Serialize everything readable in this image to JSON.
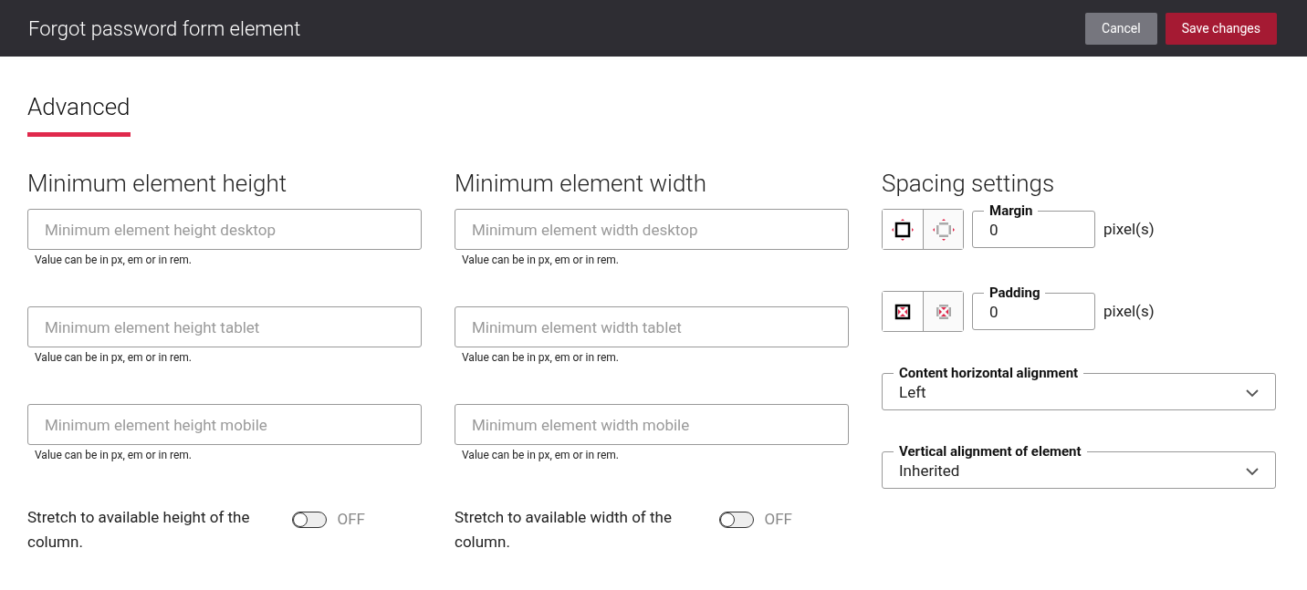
{
  "header": {
    "title": "Forgot password form element",
    "buttons": [
      {
        "label": "Cancel",
        "kind": "secondary"
      },
      {
        "label": "Save changes",
        "kind": "primary"
      }
    ]
  },
  "tabs": [
    {
      "label": "Advanced",
      "selected": true
    }
  ],
  "columns": [
    {
      "title": "Minimum element height",
      "fields": [
        {
          "placeholder": "Minimum element height desktop",
          "hint": "Value can be in px, em or in rem."
        },
        {
          "placeholder": "Minimum element height tablet",
          "hint": "Value can be in px, em or in rem."
        },
        {
          "placeholder": "Minimum element height mobile",
          "hint": "Value can be in px, em or in rem."
        }
      ],
      "toggle": {
        "label": "Stretch to available height of the column.",
        "on": false,
        "state_text": "OFF"
      }
    },
    {
      "title": "Minimum element width",
      "fields": [
        {
          "placeholder": "Minimum element width desktop",
          "hint": "Value can be in px, em or in rem."
        },
        {
          "placeholder": "Minimum element width tablet",
          "hint": "Value can be in px, em or in rem."
        },
        {
          "placeholder": "Minimum element width mobile",
          "hint": "Value can be in px, em or in rem."
        }
      ],
      "toggle": {
        "label": "Stretch to available width of the column.",
        "on": false,
        "state_text": "OFF"
      }
    }
  ],
  "spacing": {
    "title": "Spacing settings",
    "rows": [
      {
        "kind": "margin",
        "label": "Margin",
        "value": "0",
        "unit": "pixel(s)",
        "modes": [
          {
            "kind": "all",
            "selected": true
          },
          {
            "kind": "sides",
            "selected": false
          }
        ]
      },
      {
        "kind": "padding",
        "label": "Padding",
        "value": "0",
        "unit": "pixel(s)",
        "modes": [
          {
            "kind": "all",
            "selected": true
          },
          {
            "kind": "sides",
            "selected": false
          }
        ]
      }
    ],
    "selects": [
      {
        "label": "Content horizontal alignment",
        "value": "Left"
      },
      {
        "label": "Vertical alignment of element",
        "value": "Inherited"
      }
    ]
  }
}
